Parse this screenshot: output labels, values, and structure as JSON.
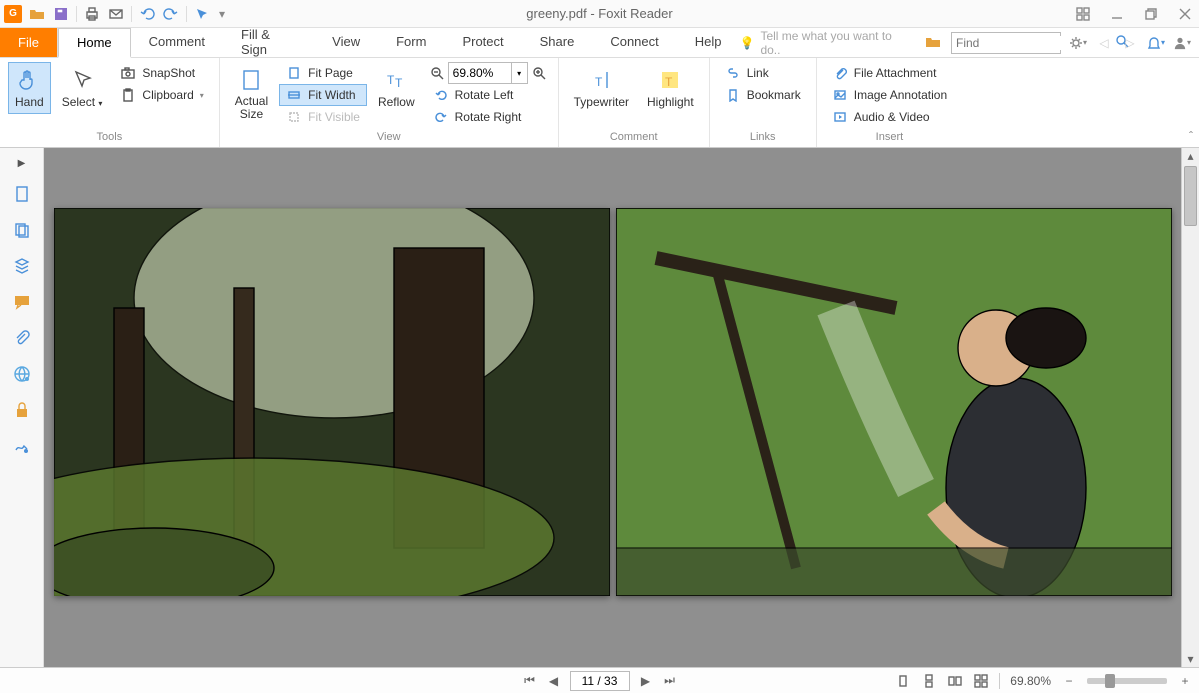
{
  "title": "greeny.pdf - Foxit Reader",
  "menu": {
    "file": "File",
    "tabs": [
      "Home",
      "Comment",
      "Fill & Sign",
      "View",
      "Form",
      "Protect",
      "Share",
      "Connect",
      "Help"
    ],
    "active": "Home",
    "tellme": "Tell me what you want to do..",
    "find_placeholder": "Find"
  },
  "ribbon": {
    "tools": {
      "hand": "Hand",
      "select": "Select",
      "snapshot": "SnapShot",
      "clipboard": "Clipboard",
      "group": "Tools"
    },
    "view": {
      "actual_size": "Actual\nSize",
      "fit_page": "Fit Page",
      "fit_width": "Fit Width",
      "fit_visible": "Fit Visible",
      "reflow": "Reflow",
      "zoom_value": "69.80%",
      "rotate_left": "Rotate Left",
      "rotate_right": "Rotate Right",
      "group": "View"
    },
    "comment": {
      "typewriter": "Typewriter",
      "highlight": "Highlight",
      "group": "Comment"
    },
    "links": {
      "link": "Link",
      "bookmark": "Bookmark",
      "group": "Links"
    },
    "insert": {
      "file_attachment": "File Attachment",
      "image_annotation": "Image Annotation",
      "audio_video": "Audio & Video",
      "group": "Insert"
    }
  },
  "status": {
    "page_field": "11 / 33",
    "zoom": "69.80%"
  }
}
